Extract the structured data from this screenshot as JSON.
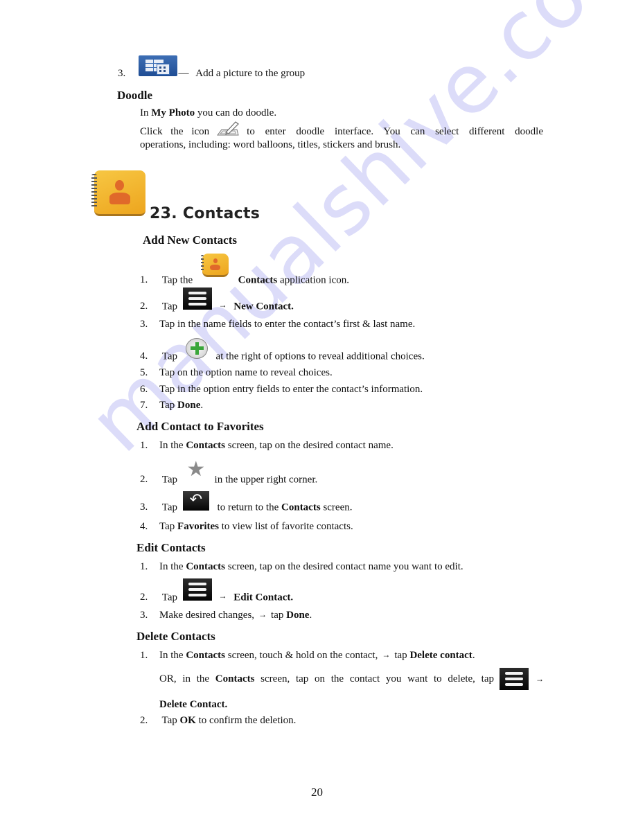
{
  "watermark": "manualshive.com",
  "intro_step": {
    "number": "3.",
    "icon": "group-picture-icon",
    "dash": "—",
    "text": "Add a picture to the group"
  },
  "doodle": {
    "heading": "Doodle",
    "line1_pre": "In ",
    "line1_bold": "My Photo",
    "line1_post": " you can do doodle.",
    "line2_pre": "Click the icon",
    "icon": "doodle-pencil-icon",
    "line2_post": "to enter doodle interface. You can select different doodle",
    "line3": "operations, including: word balloons, titles, stickers and brush."
  },
  "chapter": {
    "icon": "contacts-app-icon",
    "title": "23. Contacts"
  },
  "sections": {
    "add_new": {
      "heading": "Add New Contacts",
      "steps": [
        {
          "num": "1.",
          "pre": "Tap the",
          "icon": "contacts-app-icon",
          "bold": "Contacts",
          "post": " application icon."
        },
        {
          "num": "2.",
          "pre": "Tap",
          "icon": "menu-icon",
          "arrow": "→",
          "bold": "New Contact."
        },
        {
          "num": "3.",
          "text": "Tap in the name fields to enter the contact’s first & last name."
        },
        {
          "num": "4.",
          "pre": "Tap",
          "icon": "add-plus-icon",
          "post": "at the right of options to reveal additional choices."
        },
        {
          "num": "5.",
          "text": "Tap on the option name to reveal choices."
        },
        {
          "num": "6.",
          "text": "Tap in the option entry fields to enter the contact’s information."
        },
        {
          "num": "7.",
          "pre": "Tap ",
          "bold": "Done",
          "post": "."
        }
      ]
    },
    "favorites": {
      "heading": "Add Contact to Favorites",
      "steps": [
        {
          "num": "1.",
          "pre": "In the ",
          "bold": "Contacts",
          "post": " screen, tap on the desired contact name."
        },
        {
          "num": "2.",
          "pre": "Tap",
          "icon": "star-icon",
          "post": "in the upper right corner."
        },
        {
          "num": "3.",
          "pre": "Tap",
          "icon": "back-icon",
          "mid": "to return to the ",
          "bold": "Contacts",
          "post": " screen."
        },
        {
          "num": "4.",
          "pre": "Tap ",
          "bold": "Favorites",
          "post": " to view list of favorite contacts."
        }
      ]
    },
    "edit": {
      "heading": "Edit Contacts",
      "steps": [
        {
          "num": "1.",
          "pre": "In the ",
          "bold": "Contacts",
          "post": " screen, tap on the desired contact name you want to edit."
        },
        {
          "num": "2.",
          "pre": "Tap",
          "icon": "menu-icon",
          "arrow": "→",
          "bold": "Edit Contact."
        },
        {
          "num": "3.",
          "pre": "Make desired changes,",
          "arrow": "→",
          "mid": "tap ",
          "bold": "Done",
          "post": "."
        }
      ]
    },
    "delete": {
      "heading": "Delete Contacts",
      "steps": [
        {
          "num": "1.",
          "pre": "In the ",
          "bold": "Contacts",
          "mid": " screen, touch & hold on the contact,",
          "arrow": "→",
          "mid2": "tap ",
          "bold2": "Delete contact",
          "post": "."
        },
        {
          "num": "",
          "pre": "OR, in the ",
          "bold": "Contacts",
          "mid": " screen, tap on the contact you want to delete, tap",
          "icon": "menu-icon",
          "arrow": "→",
          "line2_bold": "Delete Contact."
        },
        {
          "num": "2.",
          "pre": " Tap ",
          "bold": "OK",
          "post": " to confirm the deletion."
        }
      ]
    }
  },
  "page_number": "20"
}
